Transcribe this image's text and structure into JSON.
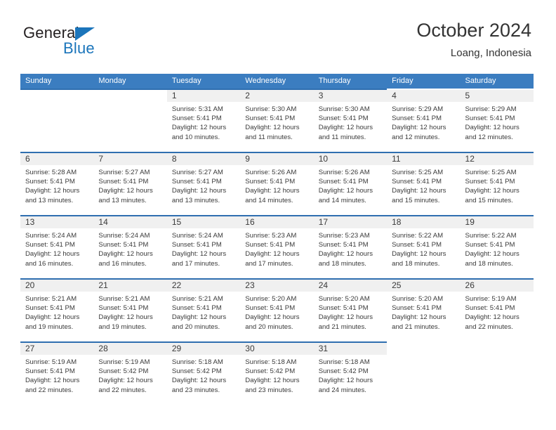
{
  "brand": {
    "name_top": "General",
    "name_bottom": "Blue",
    "accent_color": "#1b75bb"
  },
  "header": {
    "title": "October 2024",
    "subtitle": "Loang, Indonesia"
  },
  "theme": {
    "header_row_bg": "#3b7dc0",
    "week_rule": "#2f6fb0",
    "daynum_band": "#f0f0f0",
    "text": "#3a3a3a"
  },
  "weekdays": [
    "Sunday",
    "Monday",
    "Tuesday",
    "Wednesday",
    "Thursday",
    "Friday",
    "Saturday"
  ],
  "weeks": [
    [
      {
        "day": "",
        "sunrise": "",
        "sunset": "",
        "daylight1": "",
        "daylight2": "",
        "empty": true
      },
      {
        "day": "",
        "sunrise": "",
        "sunset": "",
        "daylight1": "",
        "daylight2": "",
        "empty": true
      },
      {
        "day": "1",
        "sunrise": "Sunrise: 5:31 AM",
        "sunset": "Sunset: 5:41 PM",
        "daylight1": "Daylight: 12 hours",
        "daylight2": "and 10 minutes."
      },
      {
        "day": "2",
        "sunrise": "Sunrise: 5:30 AM",
        "sunset": "Sunset: 5:41 PM",
        "daylight1": "Daylight: 12 hours",
        "daylight2": "and 11 minutes."
      },
      {
        "day": "3",
        "sunrise": "Sunrise: 5:30 AM",
        "sunset": "Sunset: 5:41 PM",
        "daylight1": "Daylight: 12 hours",
        "daylight2": "and 11 minutes."
      },
      {
        "day": "4",
        "sunrise": "Sunrise: 5:29 AM",
        "sunset": "Sunset: 5:41 PM",
        "daylight1": "Daylight: 12 hours",
        "daylight2": "and 12 minutes."
      },
      {
        "day": "5",
        "sunrise": "Sunrise: 5:29 AM",
        "sunset": "Sunset: 5:41 PM",
        "daylight1": "Daylight: 12 hours",
        "daylight2": "and 12 minutes."
      }
    ],
    [
      {
        "day": "6",
        "sunrise": "Sunrise: 5:28 AM",
        "sunset": "Sunset: 5:41 PM",
        "daylight1": "Daylight: 12 hours",
        "daylight2": "and 13 minutes."
      },
      {
        "day": "7",
        "sunrise": "Sunrise: 5:27 AM",
        "sunset": "Sunset: 5:41 PM",
        "daylight1": "Daylight: 12 hours",
        "daylight2": "and 13 minutes."
      },
      {
        "day": "8",
        "sunrise": "Sunrise: 5:27 AM",
        "sunset": "Sunset: 5:41 PM",
        "daylight1": "Daylight: 12 hours",
        "daylight2": "and 13 minutes."
      },
      {
        "day": "9",
        "sunrise": "Sunrise: 5:26 AM",
        "sunset": "Sunset: 5:41 PM",
        "daylight1": "Daylight: 12 hours",
        "daylight2": "and 14 minutes."
      },
      {
        "day": "10",
        "sunrise": "Sunrise: 5:26 AM",
        "sunset": "Sunset: 5:41 PM",
        "daylight1": "Daylight: 12 hours",
        "daylight2": "and 14 minutes."
      },
      {
        "day": "11",
        "sunrise": "Sunrise: 5:25 AM",
        "sunset": "Sunset: 5:41 PM",
        "daylight1": "Daylight: 12 hours",
        "daylight2": "and 15 minutes."
      },
      {
        "day": "12",
        "sunrise": "Sunrise: 5:25 AM",
        "sunset": "Sunset: 5:41 PM",
        "daylight1": "Daylight: 12 hours",
        "daylight2": "and 15 minutes."
      }
    ],
    [
      {
        "day": "13",
        "sunrise": "Sunrise: 5:24 AM",
        "sunset": "Sunset: 5:41 PM",
        "daylight1": "Daylight: 12 hours",
        "daylight2": "and 16 minutes."
      },
      {
        "day": "14",
        "sunrise": "Sunrise: 5:24 AM",
        "sunset": "Sunset: 5:41 PM",
        "daylight1": "Daylight: 12 hours",
        "daylight2": "and 16 minutes."
      },
      {
        "day": "15",
        "sunrise": "Sunrise: 5:24 AM",
        "sunset": "Sunset: 5:41 PM",
        "daylight1": "Daylight: 12 hours",
        "daylight2": "and 17 minutes."
      },
      {
        "day": "16",
        "sunrise": "Sunrise: 5:23 AM",
        "sunset": "Sunset: 5:41 PM",
        "daylight1": "Daylight: 12 hours",
        "daylight2": "and 17 minutes."
      },
      {
        "day": "17",
        "sunrise": "Sunrise: 5:23 AM",
        "sunset": "Sunset: 5:41 PM",
        "daylight1": "Daylight: 12 hours",
        "daylight2": "and 18 minutes."
      },
      {
        "day": "18",
        "sunrise": "Sunrise: 5:22 AM",
        "sunset": "Sunset: 5:41 PM",
        "daylight1": "Daylight: 12 hours",
        "daylight2": "and 18 minutes."
      },
      {
        "day": "19",
        "sunrise": "Sunrise: 5:22 AM",
        "sunset": "Sunset: 5:41 PM",
        "daylight1": "Daylight: 12 hours",
        "daylight2": "and 18 minutes."
      }
    ],
    [
      {
        "day": "20",
        "sunrise": "Sunrise: 5:21 AM",
        "sunset": "Sunset: 5:41 PM",
        "daylight1": "Daylight: 12 hours",
        "daylight2": "and 19 minutes."
      },
      {
        "day": "21",
        "sunrise": "Sunrise: 5:21 AM",
        "sunset": "Sunset: 5:41 PM",
        "daylight1": "Daylight: 12 hours",
        "daylight2": "and 19 minutes."
      },
      {
        "day": "22",
        "sunrise": "Sunrise: 5:21 AM",
        "sunset": "Sunset: 5:41 PM",
        "daylight1": "Daylight: 12 hours",
        "daylight2": "and 20 minutes."
      },
      {
        "day": "23",
        "sunrise": "Sunrise: 5:20 AM",
        "sunset": "Sunset: 5:41 PM",
        "daylight1": "Daylight: 12 hours",
        "daylight2": "and 20 minutes."
      },
      {
        "day": "24",
        "sunrise": "Sunrise: 5:20 AM",
        "sunset": "Sunset: 5:41 PM",
        "daylight1": "Daylight: 12 hours",
        "daylight2": "and 21 minutes."
      },
      {
        "day": "25",
        "sunrise": "Sunrise: 5:20 AM",
        "sunset": "Sunset: 5:41 PM",
        "daylight1": "Daylight: 12 hours",
        "daylight2": "and 21 minutes."
      },
      {
        "day": "26",
        "sunrise": "Sunrise: 5:19 AM",
        "sunset": "Sunset: 5:41 PM",
        "daylight1": "Daylight: 12 hours",
        "daylight2": "and 22 minutes."
      }
    ],
    [
      {
        "day": "27",
        "sunrise": "Sunrise: 5:19 AM",
        "sunset": "Sunset: 5:41 PM",
        "daylight1": "Daylight: 12 hours",
        "daylight2": "and 22 minutes."
      },
      {
        "day": "28",
        "sunrise": "Sunrise: 5:19 AM",
        "sunset": "Sunset: 5:42 PM",
        "daylight1": "Daylight: 12 hours",
        "daylight2": "and 22 minutes."
      },
      {
        "day": "29",
        "sunrise": "Sunrise: 5:18 AM",
        "sunset": "Sunset: 5:42 PM",
        "daylight1": "Daylight: 12 hours",
        "daylight2": "and 23 minutes."
      },
      {
        "day": "30",
        "sunrise": "Sunrise: 5:18 AM",
        "sunset": "Sunset: 5:42 PM",
        "daylight1": "Daylight: 12 hours",
        "daylight2": "and 23 minutes."
      },
      {
        "day": "31",
        "sunrise": "Sunrise: 5:18 AM",
        "sunset": "Sunset: 5:42 PM",
        "daylight1": "Daylight: 12 hours",
        "daylight2": "and 24 minutes."
      },
      {
        "day": "",
        "sunrise": "",
        "sunset": "",
        "daylight1": "",
        "daylight2": "",
        "empty": true
      },
      {
        "day": "",
        "sunrise": "",
        "sunset": "",
        "daylight1": "",
        "daylight2": "",
        "empty": true
      }
    ]
  ]
}
